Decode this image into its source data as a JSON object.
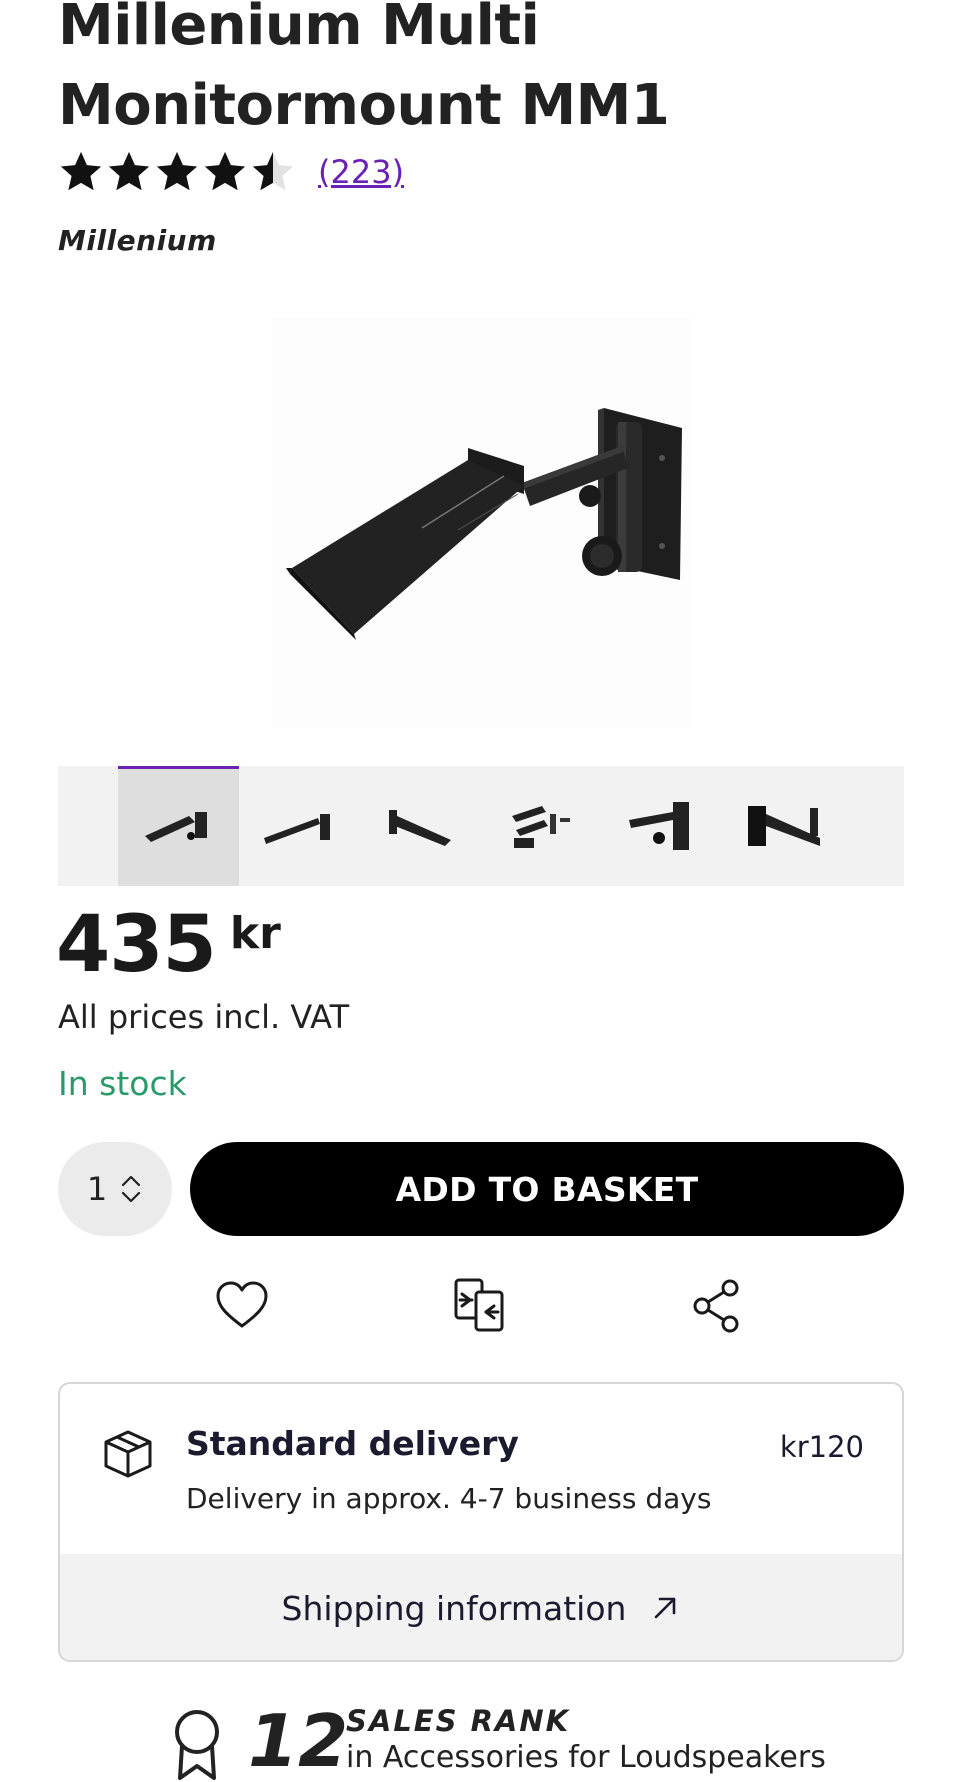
{
  "product": {
    "title": "Millenium Multi Monitormount MM1",
    "rating": 4.5,
    "review_count_label": "(223)",
    "brand": "Millenium"
  },
  "gallery": {
    "thumbnail_count": 6,
    "active_index": 0
  },
  "pricing": {
    "price": "435",
    "currency": "kr",
    "vat_note": "All prices incl. VAT",
    "stock_status": "In stock",
    "stock_color": "#2a9a6a"
  },
  "purchase": {
    "quantity": "1",
    "add_to_basket_label": "ADD TO BASKET"
  },
  "actions": {
    "wishlist_icon": "heart-icon",
    "compare_icon": "compare-icon",
    "share_icon": "share-icon"
  },
  "delivery": {
    "title": "Standard delivery",
    "price": "kr120",
    "subtitle": "Delivery in approx. 4-7 business days",
    "shipping_link_label": "Shipping information"
  },
  "sales_rank": {
    "number": "12",
    "label": "SALES RANK",
    "category": "in Accessories for Loudspeakers"
  },
  "colors": {
    "accent": "#6a1fb5",
    "button_bg": "#000000"
  }
}
